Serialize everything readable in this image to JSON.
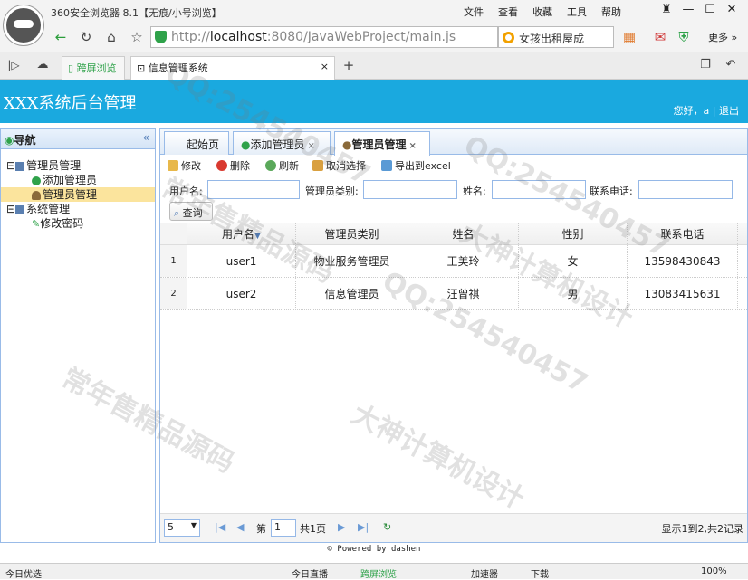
{
  "browser": {
    "title": "360安全浏览器 8.1【无痕/小号浏览】",
    "menu": [
      "文件",
      "查看",
      "收藏",
      "工具",
      "帮助"
    ],
    "window_controls": [
      "♜",
      "—",
      "☐",
      "✕"
    ],
    "url_prefix": "http://",
    "url_host": "localhost",
    "url_rest": ":8080/JavaWebProject/main.js",
    "search_text": "女孩出租屋成",
    "more_label": "更多",
    "tabs": [
      {
        "label": "跨屏浏览"
      },
      {
        "label": "信息管理系统"
      }
    ]
  },
  "app": {
    "title": "XXX系统后台管理",
    "user_greeting": "您好，a",
    "logout": "退出"
  },
  "sidebar": {
    "title": "导航",
    "collapse_glyph": "«",
    "items": [
      {
        "label": "管理员管理",
        "level": 0,
        "toggle": "⊟"
      },
      {
        "label": "添加管理员",
        "level": 1
      },
      {
        "label": "管理员管理",
        "level": 1,
        "selected": true
      },
      {
        "label": "系统管理",
        "level": 0,
        "toggle": "⊟"
      },
      {
        "label": "修改密码",
        "level": 1
      }
    ]
  },
  "main": {
    "tabs": [
      {
        "label": "起始页"
      },
      {
        "label": "添加管理员",
        "close": "×"
      },
      {
        "label": "管理员管理",
        "close": "×",
        "active": true
      }
    ],
    "toolbar": {
      "edit": "修改",
      "delete": "删除",
      "refresh": "刷新",
      "unselect": "取消选择",
      "export": "导出到excel"
    },
    "filters": {
      "username_label": "用户名:",
      "type_label": "管理员类别:",
      "name_label": "姓名:",
      "phone_label": "联系电话:",
      "username_value": "",
      "type_value": "",
      "name_value": "",
      "phone_value": "",
      "query_button": "查询"
    },
    "grid": {
      "columns": [
        "用户名",
        "管理员类别",
        "姓名",
        "性别",
        "联系电话"
      ],
      "sort_glyph": "▼",
      "rows": [
        {
          "num": "1",
          "cells": [
            "user1",
            "物业服务管理员",
            "王美玲",
            "女",
            "13598430843"
          ]
        },
        {
          "num": "2",
          "cells": [
            "user2",
            "信息管理员",
            "汪曾祺",
            "男",
            "13083415631"
          ]
        }
      ]
    },
    "pager": {
      "page_size": "5",
      "page_prefix": "第",
      "page_value": "1",
      "page_suffix": "共1页",
      "summary": "显示1到2,共2记录",
      "first_glyph": "|◀",
      "prev_glyph": "◀",
      "next_glyph": "▶",
      "last_glyph": "▶|",
      "refresh_glyph": "↻"
    }
  },
  "footer": "© Powered by dashen",
  "statusbar": {
    "left": "今日优选",
    "items": [
      "今日直播",
      "跨屏浏览",
      "加速器",
      "下载",
      "100%"
    ]
  },
  "watermark": {
    "texts": [
      "QQ:254540457",
      "常年售精品源码",
      "大神计算机设计"
    ]
  }
}
